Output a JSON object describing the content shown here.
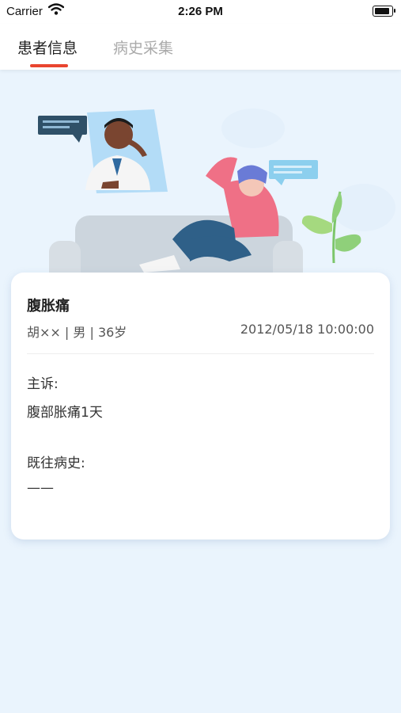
{
  "status_bar": {
    "carrier": "Carrier",
    "time": "2:26 PM"
  },
  "tabs": [
    {
      "label": "患者信息",
      "active": true
    },
    {
      "label": "病史采集",
      "active": false
    }
  ],
  "colors": {
    "accent": "#e9452f",
    "background": "#eaf4fd"
  },
  "illustration": {
    "name": "doctor-video-consultation-illustration"
  },
  "record": {
    "title": "腹胀痛",
    "patient_info": "胡×× | 男 | 36岁",
    "datetime": "2012/05/18 10:00:00",
    "complaint_label": "主诉:",
    "complaint_value": "腹部胀痛1天",
    "history_label": "既往病史:",
    "history_value": "——"
  }
}
